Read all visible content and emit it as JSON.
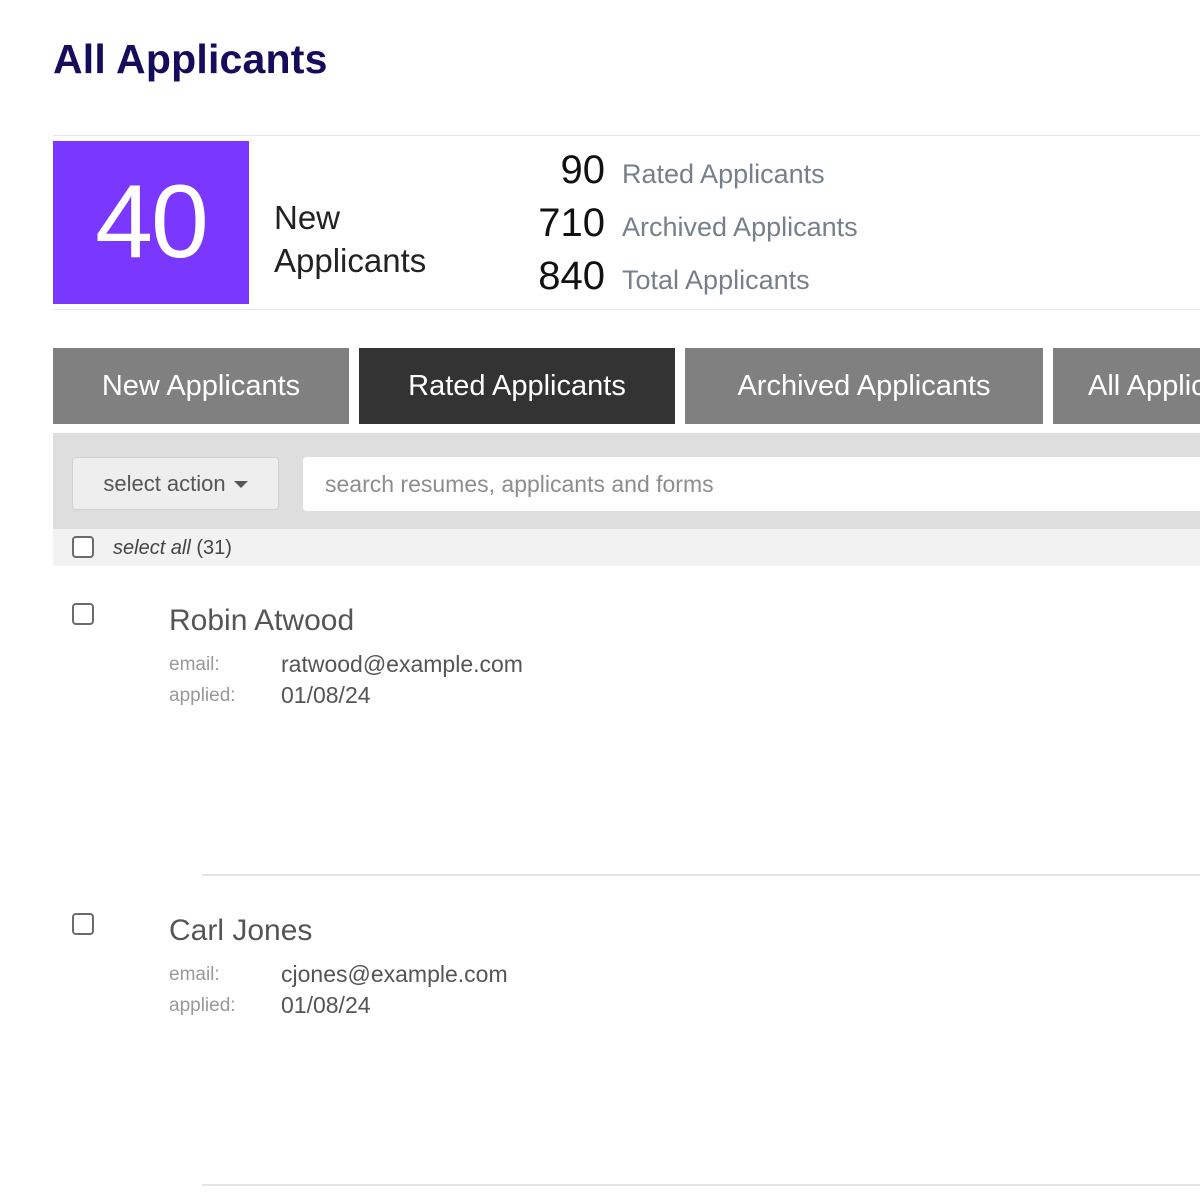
{
  "page": {
    "title": "All Applicants"
  },
  "summary": {
    "new_count": "40",
    "new_label": "New\nApplicants",
    "stats": [
      {
        "value": "90",
        "label": "Rated Applicants"
      },
      {
        "value": "710",
        "label": "Archived Applicants"
      },
      {
        "value": "840",
        "label": "Total Applicants"
      }
    ]
  },
  "tabs": [
    {
      "label": "New Applicants",
      "active": false
    },
    {
      "label": "Rated Applicants",
      "active": true
    },
    {
      "label": "Archived Applicants",
      "active": false
    },
    {
      "label": "All Applicants",
      "active": false
    }
  ],
  "toolbar": {
    "action_label": "select action",
    "search_placeholder": "search resumes, applicants and forms",
    "search_value": ""
  },
  "select_all": {
    "label": "select all",
    "count": "(31)"
  },
  "labels": {
    "email": "email:",
    "applied": "applied:"
  },
  "applicants": [
    {
      "name": "Robin Atwood",
      "email": "ratwood@example.com",
      "applied": "01/08/24"
    },
    {
      "name": "Carl Jones",
      "email": "cjones@example.com",
      "applied": "01/08/24"
    }
  ],
  "colors": {
    "title": "#150c5c",
    "new_count_bg": "#7a37ff",
    "tab_active": "#333333",
    "tab_inactive": "#808080"
  },
  "icons": {
    "action_dropdown": "caret-down-icon"
  }
}
